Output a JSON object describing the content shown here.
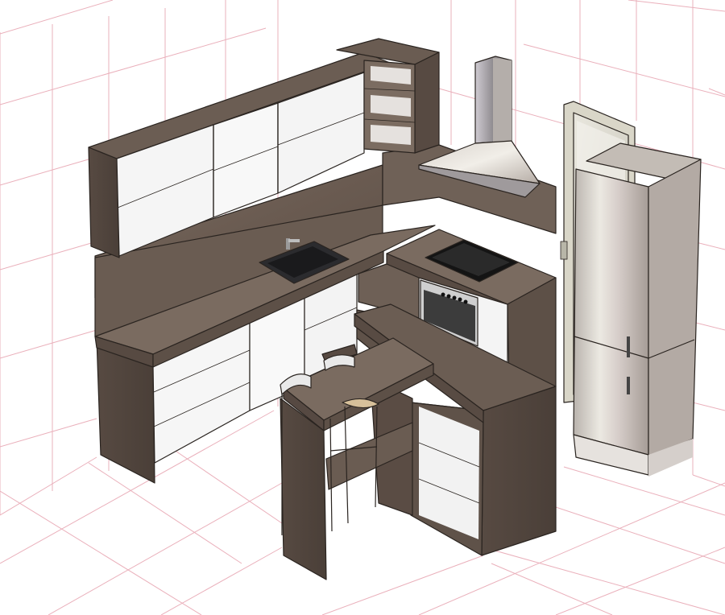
{
  "viewport": {
    "background": "#ffffff",
    "grid_color": "#e8a8b4",
    "palette": {
      "wood": "#6b5d53",
      "wood_dark": "#4f433b",
      "wood_light": "#7d6e63",
      "cabinet_front": "#f7f7f7",
      "stainless": "#c8c4bc",
      "glass_black": "#151515",
      "sink": "#2a2a2d",
      "door_frame": "#d9d6c8"
    },
    "icons": {
      "hood": "extractor-hood-icon",
      "hob": "cooktop-icon",
      "oven": "oven-icon",
      "sink": "sink-icon",
      "fridge": "fridge-icon",
      "door": "door-icon",
      "stool": "bar-stool-icon"
    }
  }
}
